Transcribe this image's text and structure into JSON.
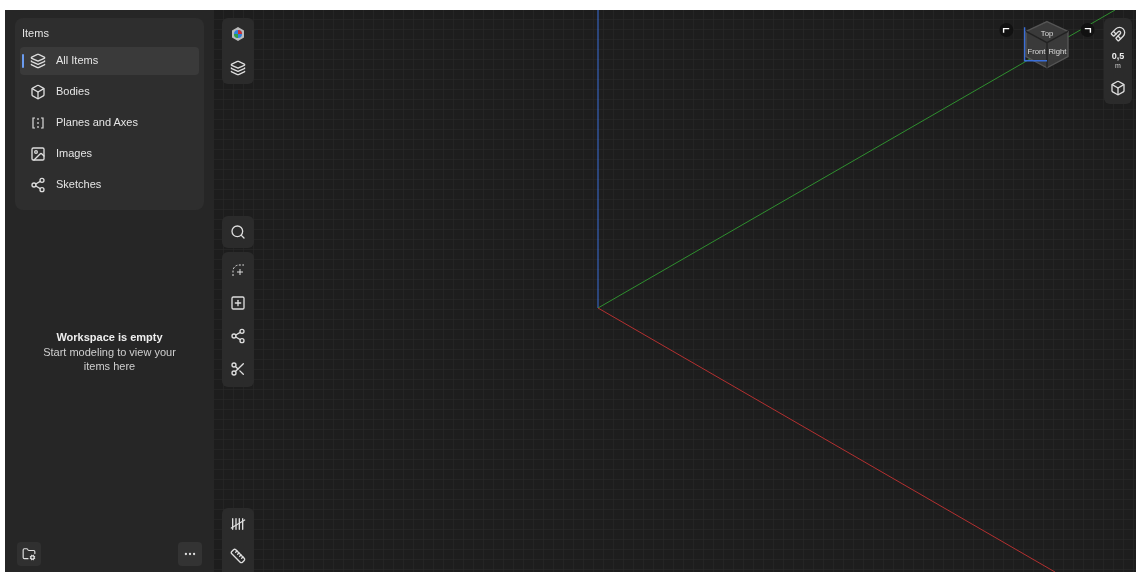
{
  "items_panel": {
    "title": "Items",
    "items": [
      {
        "label": "All Items",
        "selected": true
      },
      {
        "label": "Bodies",
        "selected": false
      },
      {
        "label": "Planes and Axes",
        "selected": false
      },
      {
        "label": "Images",
        "selected": false
      },
      {
        "label": "Sketches",
        "selected": false
      }
    ]
  },
  "empty_state": {
    "title": "Workspace is empty",
    "message": "Start modeling to view your items here"
  },
  "view_cube": {
    "faces": [
      "Top",
      "Front",
      "Right"
    ]
  },
  "snap": {
    "value": "0,5",
    "unit": "m"
  }
}
